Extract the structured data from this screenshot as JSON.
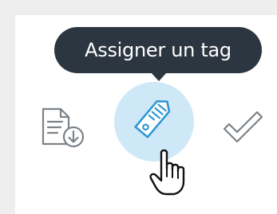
{
  "tooltip": {
    "text": "Assigner un tag"
  },
  "toolbar": {
    "icons": [
      "document-download-icon",
      "tag-icon",
      "checkmark-icon"
    ],
    "active_icon": "tag-icon"
  },
  "cursor": {
    "icon": "hand-pointer-icon"
  },
  "colors": {
    "background": "#eeeeee",
    "panel": "#ffffff",
    "tooltip_bg": "#2c3640",
    "tooltip_text": "#ffffff",
    "icon_gray": "#7b8288",
    "accent": "#2f98d4",
    "highlight": "#cfe8f8"
  }
}
